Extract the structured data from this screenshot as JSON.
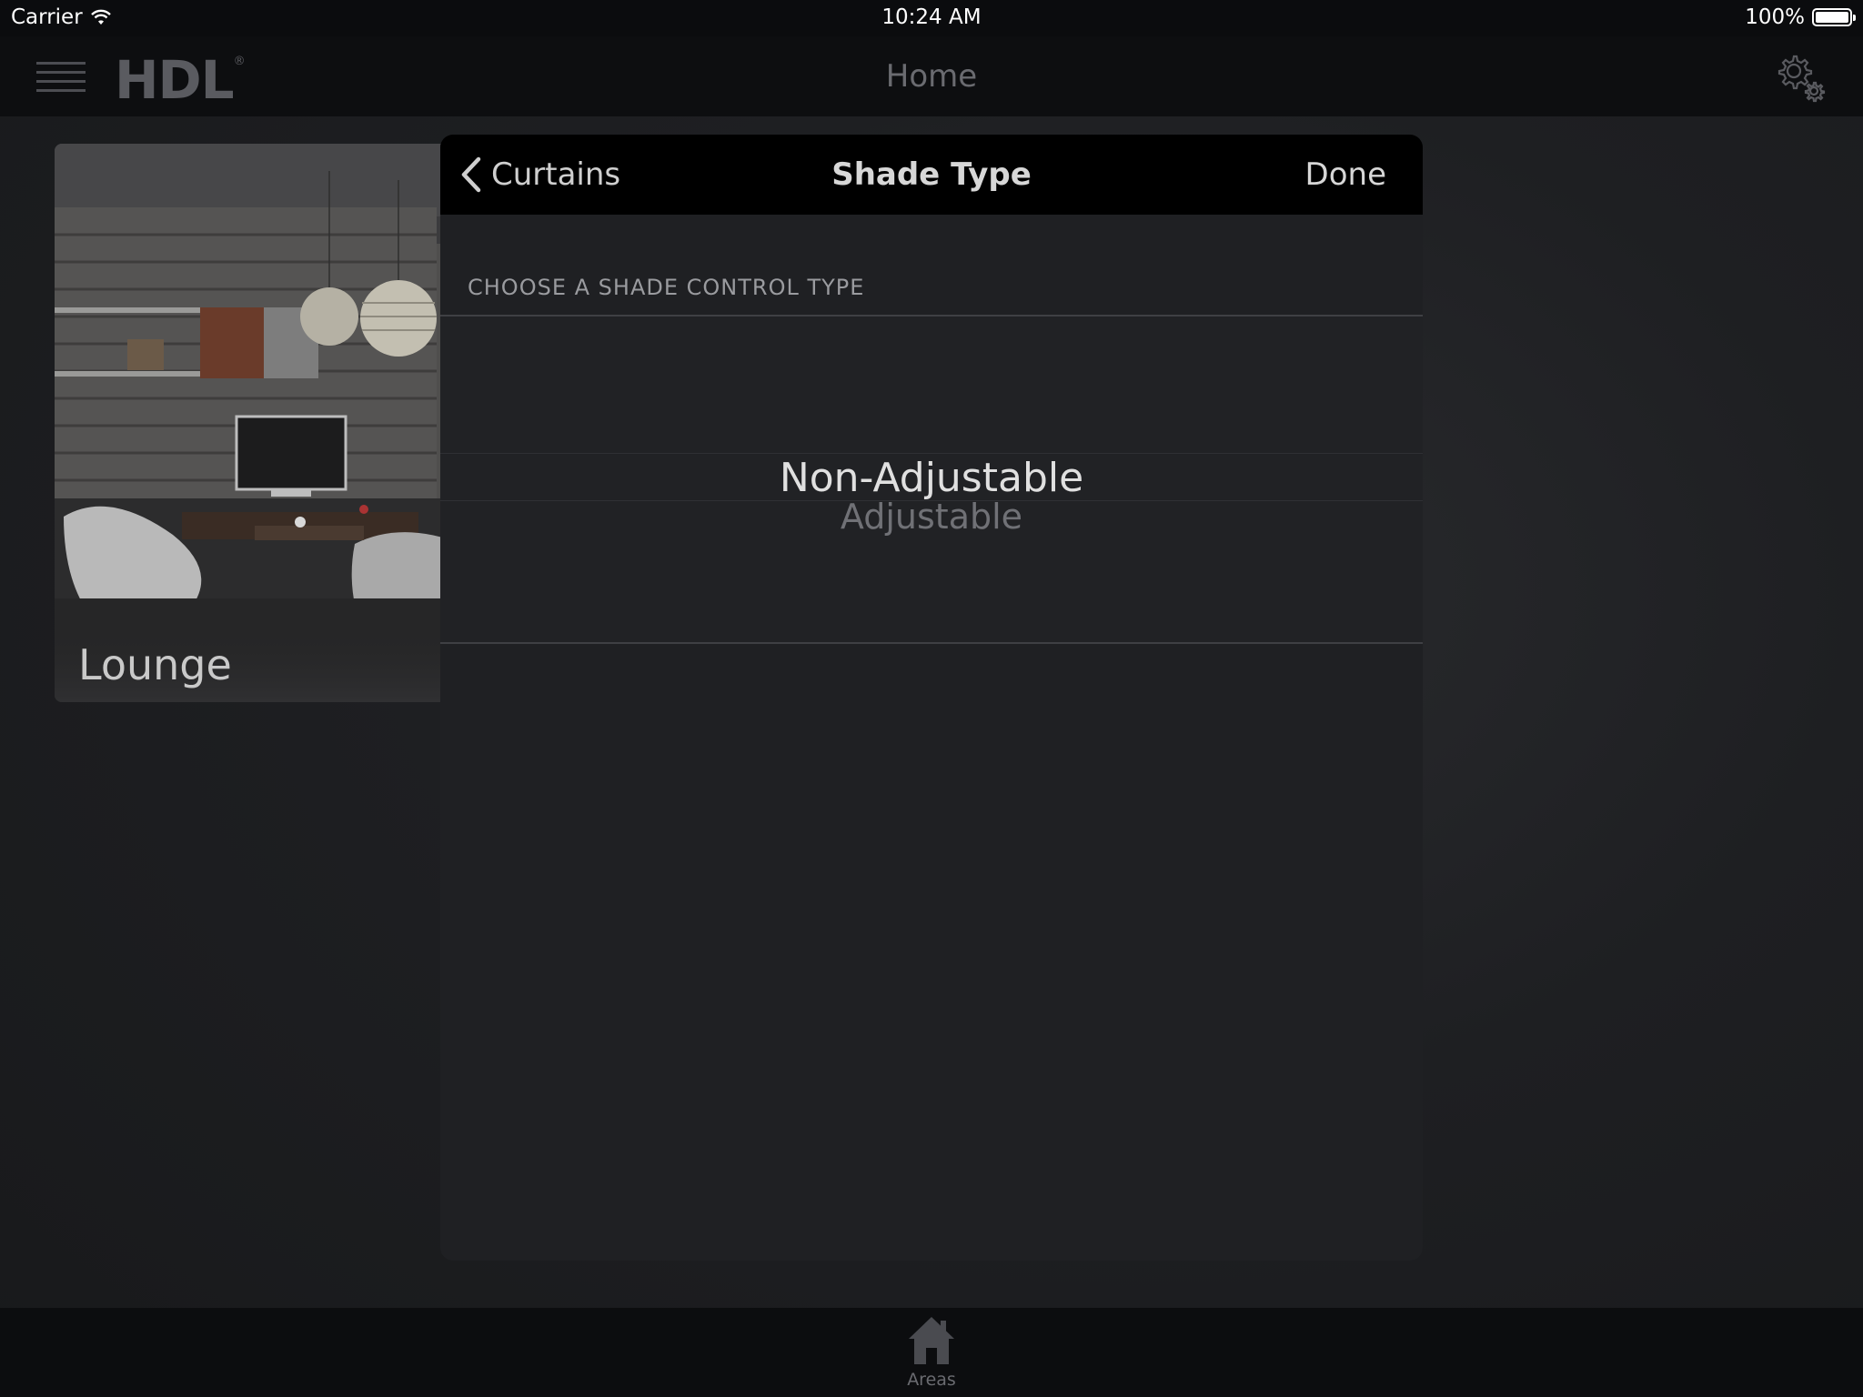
{
  "status_bar": {
    "carrier": "Carrier",
    "time": "10:24 AM",
    "battery": "100%"
  },
  "nav_bar": {
    "logo": "HDL",
    "logo_mark": "®",
    "title": "Home"
  },
  "area_card": {
    "label": "Lounge"
  },
  "modal": {
    "back_label": "Curtains",
    "title": "Shade Type",
    "done_label": "Done",
    "section_header": "CHOOSE A SHADE CONTROL TYPE",
    "picker": {
      "selected": "Non-Adjustable",
      "options": [
        "Non-Adjustable",
        "Adjustable"
      ]
    }
  },
  "tab_bar": {
    "areas_label": "Areas"
  },
  "colors": {
    "background": "#1c1d20",
    "modal": "#1f2023",
    "header": "#000000",
    "accent_text": "#d7d7d7"
  }
}
